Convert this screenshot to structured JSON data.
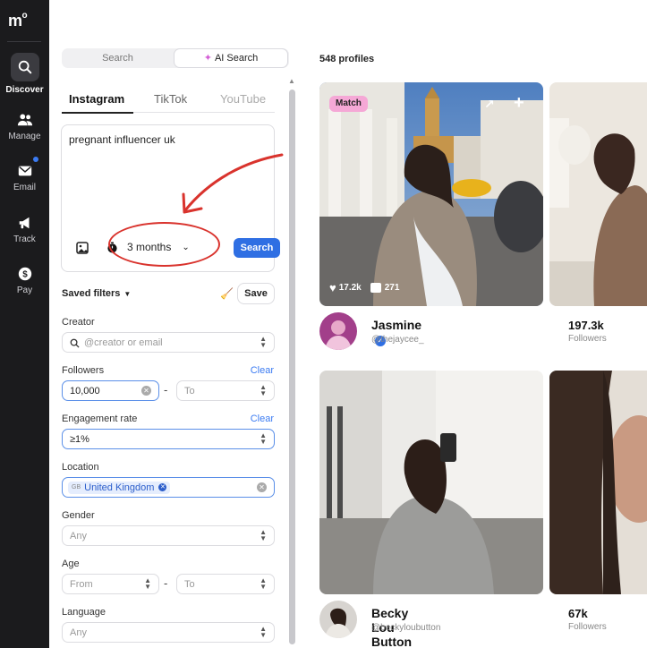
{
  "sidebar": {
    "logo": "m",
    "logo_sup": "o",
    "items": [
      {
        "label": "Discover",
        "icon": "search-icon"
      },
      {
        "label": "Manage",
        "icon": "people-icon"
      },
      {
        "label": "Email",
        "icon": "mail-icon"
      },
      {
        "label": "Track",
        "icon": "megaphone-icon"
      },
      {
        "label": "Pay",
        "icon": "dollar-icon"
      }
    ]
  },
  "search_mode": {
    "search": "Search",
    "ai_search": "AI Search"
  },
  "platform_tabs": [
    "Instagram",
    "TikTok",
    "YouTube"
  ],
  "query": {
    "text": "pregnant influencer uk",
    "timeframe": "3 months",
    "search_button": "Search"
  },
  "saved_filters": {
    "label": "Saved filters",
    "save_button": "Save"
  },
  "filters": {
    "creator": {
      "label": "Creator",
      "placeholder": "@creator or email"
    },
    "followers": {
      "label": "Followers",
      "clear": "Clear",
      "from": "10,000",
      "to": "To"
    },
    "engagement": {
      "label": "Engagement rate",
      "clear": "Clear",
      "value": "≥1%"
    },
    "location": {
      "label": "Location",
      "flag": "GB",
      "chip": "United Kingdom"
    },
    "gender": {
      "label": "Gender",
      "value": "Any"
    },
    "age": {
      "label": "Age",
      "from": "From",
      "to": "To"
    },
    "language": {
      "label": "Language",
      "value": "Any"
    }
  },
  "results": {
    "count": "548 profiles",
    "profiles": [
      {
        "badge": "Match",
        "likes": "17.2k",
        "comments": "271",
        "name": "Jasmine",
        "handle": "@thejaycee_",
        "followers": "197.3k",
        "followers_label": "Followers"
      },
      {
        "name": "Becky Lou Button",
        "handle": "@beckyloubutton",
        "followers": "67k",
        "followers_label": "Followers"
      }
    ]
  },
  "colors": {
    "accent": "#2f6fe3",
    "annotation": "#d9332d",
    "match_badge": "#f5a8d6"
  }
}
